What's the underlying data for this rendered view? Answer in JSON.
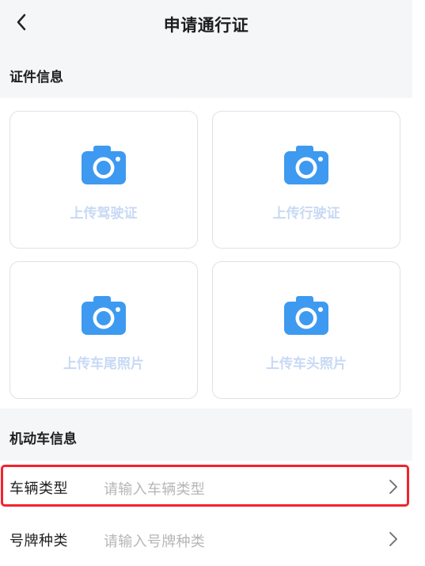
{
  "header": {
    "title": "申请通行证",
    "back_icon": "back-arrow-icon"
  },
  "sections": {
    "documents": {
      "title": "证件信息",
      "cards": [
        {
          "label": "上传驾驶证",
          "icon": "camera-icon"
        },
        {
          "label": "上传行驶证",
          "icon": "camera-icon"
        },
        {
          "label": "上传车尾照片",
          "icon": "camera-icon"
        },
        {
          "label": "上传车头照片",
          "icon": "camera-icon"
        }
      ]
    },
    "vehicle": {
      "title": "机动车信息",
      "rows": [
        {
          "label": "车辆类型",
          "placeholder": "请输入车辆类型",
          "icon": "chevron-right-icon"
        },
        {
          "label": "号牌种类",
          "placeholder": "请输入号牌种类",
          "icon": "chevron-right-icon"
        }
      ]
    }
  },
  "colors": {
    "accent": "#3d9af0",
    "upload_text": "#c7d9f4",
    "highlight": "#f1232d",
    "background": "#f6f7f9"
  }
}
